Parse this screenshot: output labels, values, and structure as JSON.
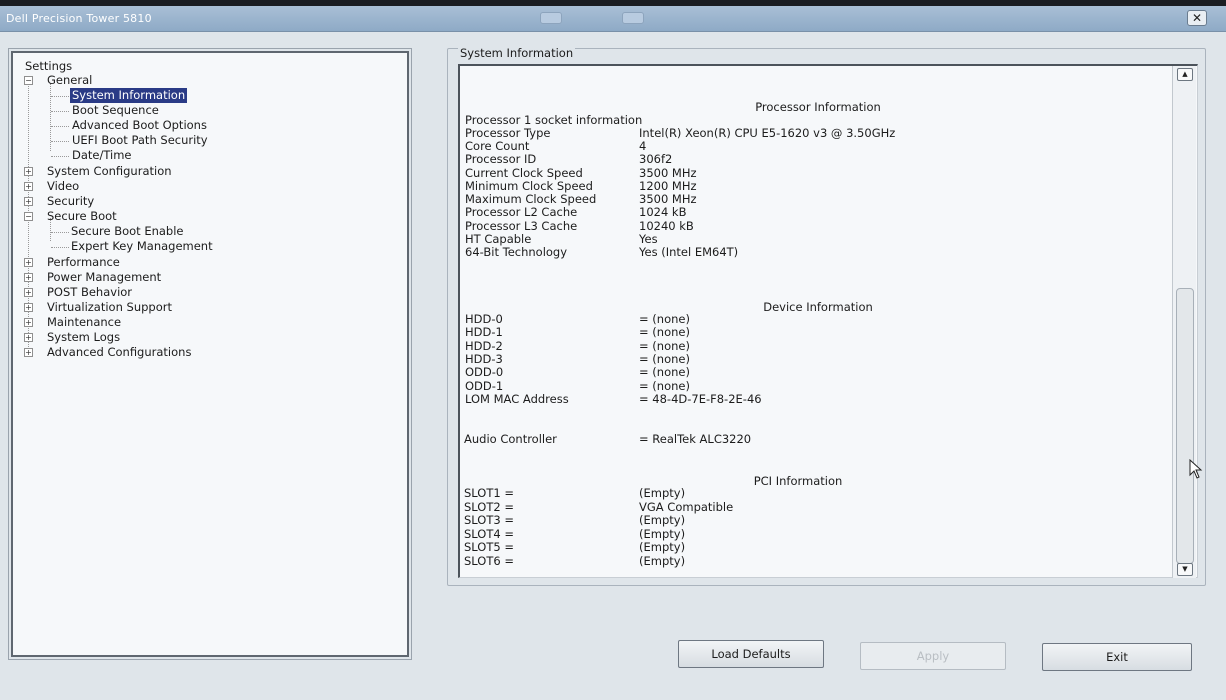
{
  "window": {
    "title": "Dell Precision Tower 5810",
    "close_glyph": "✕"
  },
  "tree": {
    "root": "Settings",
    "items": [
      {
        "label": "General",
        "expander": "−"
      },
      {
        "label": "System Information"
      },
      {
        "label": "Boot Sequence"
      },
      {
        "label": "Advanced Boot Options"
      },
      {
        "label": "UEFI Boot Path Security"
      },
      {
        "label": "Date/Time"
      },
      {
        "label": "System Configuration",
        "expander": "+"
      },
      {
        "label": "Video",
        "expander": "+"
      },
      {
        "label": "Security",
        "expander": "+"
      },
      {
        "label": "Secure Boot",
        "expander": "−"
      },
      {
        "label": "Secure Boot Enable"
      },
      {
        "label": "Expert Key Management"
      },
      {
        "label": "Performance",
        "expander": "+"
      },
      {
        "label": "Power Management",
        "expander": "+"
      },
      {
        "label": "POST Behavior",
        "expander": "+"
      },
      {
        "label": "Virtualization Support",
        "expander": "+"
      },
      {
        "label": "Maintenance",
        "expander": "+"
      },
      {
        "label": "System Logs",
        "expander": "+"
      },
      {
        "label": "Advanced Configurations",
        "expander": "+"
      }
    ]
  },
  "info": {
    "group_label": "System Information",
    "processor": {
      "heading": "Processor Information",
      "subheading": "Processor 1 socket information",
      "rows": [
        {
          "label": "Processor Type",
          "value": "Intel(R) Xeon(R) CPU E5-1620 v3 @ 3.50GHz"
        },
        {
          "label": "Core Count",
          "value": "4"
        },
        {
          "label": "Processor ID",
          "value": "306f2"
        },
        {
          "label": "Current Clock Speed",
          "value": "3500 MHz"
        },
        {
          "label": "Minimum Clock Speed",
          "value": "1200 MHz"
        },
        {
          "label": "Maximum Clock Speed",
          "value": "3500 MHz"
        },
        {
          "label": "Processor L2 Cache",
          "value": "1024 kB"
        },
        {
          "label": "Processor L3 Cache",
          "value": "10240 kB"
        },
        {
          "label": "HT Capable",
          "value": "Yes"
        },
        {
          "label": "64-Bit Technology",
          "value": "Yes (Intel EM64T)"
        }
      ]
    },
    "device": {
      "heading": "Device Information",
      "rows": [
        {
          "label": "HDD-0",
          "value": "= (none)"
        },
        {
          "label": "HDD-1",
          "value": "= (none)"
        },
        {
          "label": "HDD-2",
          "value": "= (none)"
        },
        {
          "label": "HDD-3",
          "value": "= (none)"
        },
        {
          "label": "ODD-0",
          "value": "= (none)"
        },
        {
          "label": "ODD-1",
          "value": "= (none)"
        },
        {
          "label": "LOM MAC Address",
          "value": "= 48-4D-7E-F8-2E-46"
        }
      ],
      "audio": {
        "label": "Audio Controller",
        "value": "= RealTek ALC3220"
      }
    },
    "pci": {
      "heading": "PCI Information",
      "rows": [
        {
          "label": "SLOT1 =",
          "value": "(Empty)"
        },
        {
          "label": "SLOT2 =",
          "value": "VGA Compatible"
        },
        {
          "label": "SLOT3 =",
          "value": "(Empty)"
        },
        {
          "label": "SLOT4 =",
          "value": "(Empty)"
        },
        {
          "label": "SLOT5 =",
          "value": "(Empty)"
        },
        {
          "label": "SLOT6 =",
          "value": "(Empty)"
        }
      ]
    }
  },
  "scroll": {
    "up_glyph": "▲",
    "down_glyph": "▼"
  },
  "buttons": {
    "load_defaults": "Load Defaults",
    "apply": "Apply",
    "exit": "Exit"
  }
}
